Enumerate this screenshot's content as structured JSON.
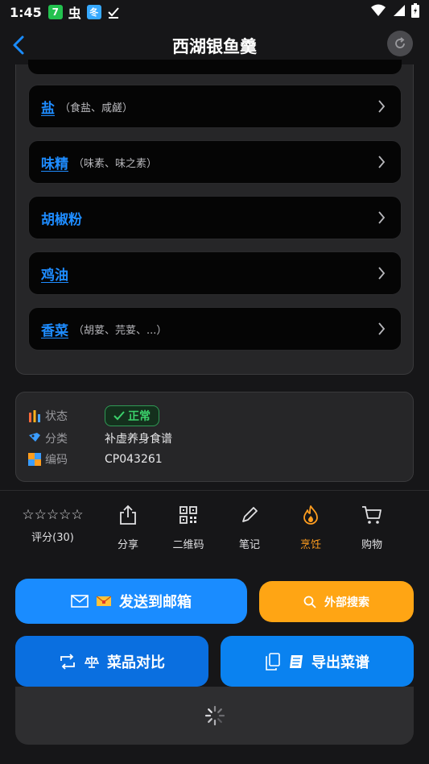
{
  "status_bar": {
    "time": "1:45",
    "icons": [
      "app-7-icon",
      "bug-icon",
      "app-icon",
      "download-done-icon",
      "wifi-icon",
      "signal-icon",
      "battery-icon"
    ]
  },
  "header": {
    "title": "西湖银鱼羹"
  },
  "ingredients": [
    {
      "name": "盐",
      "alias": "（食盐、咸鹾）"
    },
    {
      "name": "味精",
      "alias": "（味素、味之素）"
    },
    {
      "name": "胡椒粉",
      "alias": ""
    },
    {
      "name": "鸡油",
      "alias": ""
    },
    {
      "name": "香菜",
      "alias": "（胡荽、芫荽、...）"
    }
  ],
  "info": {
    "status_label": "状态",
    "status_value": "正常",
    "category_label": "分类",
    "category_value": "补虚养身食谱",
    "code_label": "编码",
    "code_value": "CP043261"
  },
  "actions": {
    "stars": "☆☆☆☆☆",
    "rating_label": "评分(30)",
    "share": "分享",
    "qrcode": "二维码",
    "note": "笔记",
    "cook": "烹饪",
    "shop": "购物"
  },
  "buttons": {
    "email": "发送到邮箱",
    "search": "外部搜索",
    "compare": "菜品对比",
    "export": "导出菜谱"
  },
  "colors": {
    "accent_blue": "#1a8cff",
    "accent_orange": "#ffa514",
    "status_green": "#3bd16b",
    "background": "#161618"
  }
}
